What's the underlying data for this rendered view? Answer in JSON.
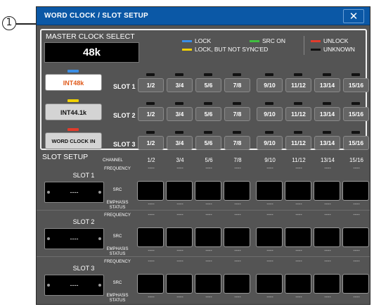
{
  "callout": {
    "number": "1"
  },
  "window": {
    "title": "WORD CLOCK / SLOT SETUP",
    "close_label": "✕"
  },
  "master_clock": {
    "title": "MASTER CLOCK SELECT",
    "rate": "48k",
    "legend": [
      {
        "label": "LOCK",
        "color": "#3a8ee6"
      },
      {
        "label": "SRC ON",
        "color": "#3fbf3f"
      },
      {
        "label": "UNLOCK",
        "color": "#e23b2b"
      },
      {
        "label": "LOCK, BUT NOT SYNC'ED",
        "color": "#f0d000"
      },
      {
        "label": "UNKNOWN",
        "color": "#111111"
      }
    ],
    "sources": [
      {
        "label": "INT48k",
        "indicator": "#3a8ee6",
        "selected": true
      },
      {
        "label": "INT44.1k",
        "indicator": "#f0d000",
        "selected": false
      },
      {
        "label": "WORD CLOCK IN",
        "indicator": "#e23b2b",
        "selected": false
      }
    ],
    "slots": [
      {
        "label": "SLOT 1"
      },
      {
        "label": "SLOT 2"
      },
      {
        "label": "SLOT 3"
      }
    ],
    "channels": [
      "1/2",
      "3/4",
      "5/6",
      "7/8",
      "9/10",
      "11/12",
      "13/14",
      "15/16"
    ]
  },
  "slot_setup": {
    "title": "SLOT SETUP",
    "channel_label": "CHANNEL",
    "row_labels": {
      "frequency": "FREQUENCY",
      "src": "SRC",
      "emphasis": "EMPHASIS STATUS"
    },
    "empty_value": "----",
    "slots": [
      {
        "name": "SLOT 1",
        "device": "----"
      },
      {
        "name": "SLOT 2",
        "device": "----"
      },
      {
        "name": "SLOT 3",
        "device": "----"
      }
    ]
  }
}
